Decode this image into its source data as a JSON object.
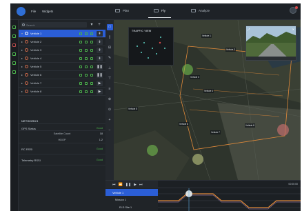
{
  "header": {
    "menu": [
      "File",
      "Widgets"
    ],
    "tabs": [
      {
        "label": "Plan",
        "active": false
      },
      {
        "label": "Fly",
        "active": true
      },
      {
        "label": "Analyze",
        "active": false
      }
    ]
  },
  "sidebar": {
    "search_placeholder": "Search",
    "vehicles": [
      {
        "label": "Vehicle 1",
        "selected": true
      },
      {
        "label": "Vehicle 2",
        "selected": false
      },
      {
        "label": "Vehicle 3",
        "selected": false
      },
      {
        "label": "Vehicle 4",
        "selected": false
      },
      {
        "label": "Vehicle 5",
        "selected": false
      },
      {
        "label": "Vehicle 6",
        "selected": false
      },
      {
        "label": "Vehicle 7",
        "selected": false
      },
      {
        "label": "Vehicle 8",
        "selected": false
      }
    ]
  },
  "network": {
    "heading": "NETWORKS",
    "gps_status": "GPS Status",
    "gps_good": "Good",
    "satellite_count_label": "Satellite Count",
    "satellite_count": "18",
    "hdop_label": "HDOP",
    "hdop": "1.2",
    "rc_label": "RC RSSI",
    "rc_good": "Good",
    "telemetry_label": "Telemetry RSSI",
    "telemetry_good": "Good"
  },
  "map": {
    "traffic_title": "TRAFFIC VIEW",
    "vehicle_labels": [
      "Vehicle 1",
      "Vehicle 2",
      "Vehicle 3",
      "Vehicle 4",
      "Vehicle 5",
      "Vehicle 6",
      "Vehicle 7",
      "Vehicle 8"
    ]
  },
  "timeline": {
    "items": [
      "Vehicle 1",
      "Mission 1",
      "ELD Site 1"
    ],
    "zoom": "00:00:00"
  },
  "colors": {
    "accent": "#2b5ed6",
    "good": "#4bb34b",
    "path": "#e08a3a"
  }
}
